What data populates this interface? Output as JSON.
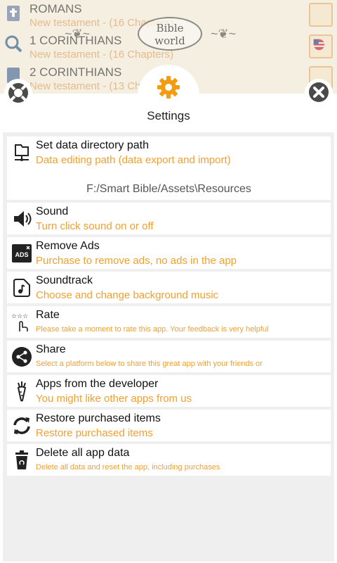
{
  "background": {
    "rows": [
      {
        "title": "ROMANS",
        "subtitle": "New testament - (16 Chapters)"
      },
      {
        "title": "1 CORINTHIANS",
        "subtitle": "New testament - (16 Chapters)"
      },
      {
        "title": "2 CORINTHIANS",
        "subtitle": "New testament - (13 Chapters)"
      }
    ],
    "logo_line1": "Bible",
    "logo_line2": "world"
  },
  "header": {
    "title": "Settings",
    "icons": {
      "left": "lifebuoy-icon",
      "center": "gear-icon",
      "right": "close-icon"
    },
    "accent": "#f0a030"
  },
  "items": [
    {
      "title": "Set data directory path",
      "subtitle": "Data editing path (data export and import)",
      "value": "F:/Smart Bible/Assets\\Resources",
      "icon": "folder-network-icon"
    },
    {
      "title": "Sound",
      "subtitle": "Turn click sound on or off",
      "icon": "speaker-icon"
    },
    {
      "title": "Remove Ads",
      "subtitle": "Purchase to remove ads, no ads in the app",
      "icon": "ads-off-icon",
      "icon_text": "ADS"
    },
    {
      "title": "Soundtrack",
      "subtitle": "Choose and change background music",
      "icon": "music-file-icon"
    },
    {
      "title": "Rate",
      "subtitle": "Please take a moment to rate this app. Your feedback is very helpful",
      "icon": "rate-stars-icon"
    },
    {
      "title": "Share",
      "subtitle": "Select a platform below to share this great app with your friends or",
      "icon": "share-icon"
    },
    {
      "title": "Apps from the developer",
      "subtitle": "You might like other apps from us",
      "icon": "carrot-icon"
    },
    {
      "title": "Restore purchased items",
      "subtitle": "Restore purchased items",
      "icon": "refresh-icon"
    },
    {
      "title": "Delete all app data",
      "subtitle": "Delete all data and reset the app, including purchases",
      "icon": "trash-icon"
    }
  ]
}
